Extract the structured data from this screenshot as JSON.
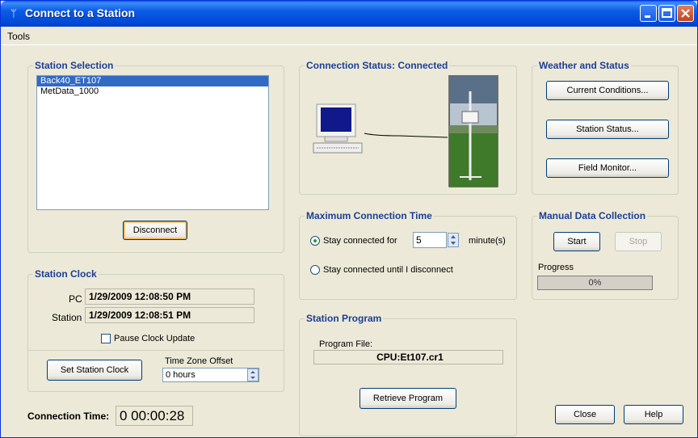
{
  "window": {
    "title": "Connect to a Station"
  },
  "menu": {
    "tools": "Tools"
  },
  "station_selection": {
    "title": "Station Selection",
    "stations": [
      "Back40_ET107",
      "MetData_1000"
    ],
    "selected_index": 0,
    "disconnect": "Disconnect"
  },
  "connection_status": {
    "title": "Connection Status: Connected"
  },
  "weather": {
    "title": "Weather and Status",
    "current_conditions": "Current Conditions...",
    "station_status": "Station Status...",
    "field_monitor": "Field Monitor..."
  },
  "max_conn": {
    "title": "Maximum Connection Time",
    "stay_for": "Stay connected for",
    "minutes_value": "5",
    "minutes_unit": "minute(s)",
    "stay_until": "Stay connected until I disconnect"
  },
  "manual": {
    "title": "Manual Data Collection",
    "start": "Start",
    "stop": "Stop",
    "progress_label": "Progress",
    "progress_text": "0%",
    "progress_value": 0
  },
  "clock": {
    "title": "Station Clock",
    "pc_label": "PC",
    "pc_value": "1/29/2009 12:08:50 PM",
    "station_label": "Station",
    "station_value": "1/29/2009 12:08:51 PM",
    "pause": "Pause Clock Update",
    "set_clock": "Set Station Clock",
    "tz_label": "Time Zone Offset",
    "tz_value": "0 hours"
  },
  "program": {
    "title": "Station Program",
    "file_label": "Program File:",
    "file_value": "CPU:Et107.cr1",
    "retrieve": "Retrieve Program"
  },
  "connection_time": {
    "label": "Connection Time:",
    "value": "0 00:00:28"
  },
  "footer": {
    "close": "Close",
    "help": "Help"
  },
  "colors": {
    "title_bar": "#0a5be6",
    "group_title": "#1c3f95",
    "selection": "#316ac5"
  }
}
